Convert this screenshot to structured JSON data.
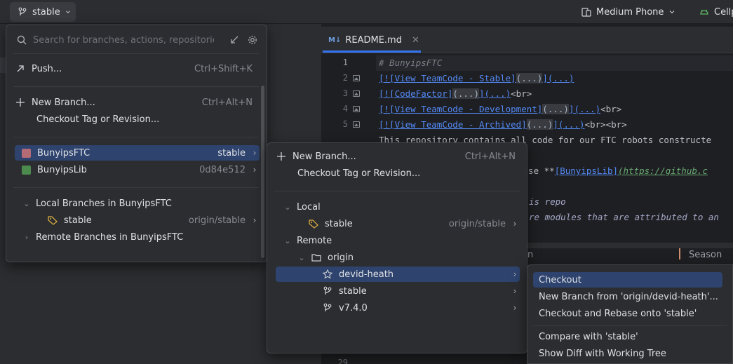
{
  "toolbar": {
    "branch": "stable",
    "device": "Medium Phone",
    "cell_label": "Cellp"
  },
  "editor": {
    "tab_label": "README.md",
    "tab_badge": "M↓",
    "line_numbers": [
      "1",
      "2",
      "3",
      "4",
      "5",
      "29"
    ],
    "table_header_right": "Season",
    "table_header_left": "n"
  },
  "branch_popup": {
    "search_placeholder": "Search for branches, actions, repositories",
    "push": {
      "label": "Push...",
      "shortcut": "Ctrl+Shift+K"
    },
    "new_branch": {
      "label": "New Branch...",
      "shortcut": "Ctrl+Alt+N"
    },
    "checkout_tag": "Checkout Tag or Revision...",
    "repos": [
      {
        "name": "BunyipsFTC",
        "branch": "stable",
        "color": "#b36b76"
      },
      {
        "name": "BunyipsLib",
        "branch": "0d84e512",
        "color": "#4d8a4d"
      }
    ],
    "local_header": "Local Branches in BunyipsFTC",
    "local_branch": {
      "name": "stable",
      "tracking": "origin/stable"
    },
    "remote_header": "Remote Branches in BunyipsFTC"
  },
  "repo_popup": {
    "new_branch": {
      "label": "New Branch...",
      "shortcut": "Ctrl+Alt+N"
    },
    "checkout_tag": "Checkout Tag or Revision...",
    "local_header": "Local",
    "local_branch": {
      "name": "stable",
      "tracking": "origin/stable"
    },
    "remote_header": "Remote",
    "remote_name": "origin",
    "remote_branches": [
      "devid-heath",
      "stable",
      "v7.4.0"
    ]
  },
  "branch_actions": {
    "items": [
      "Checkout",
      "New Branch from 'origin/devid-heath'...",
      "Checkout and Rebase onto 'stable'",
      "Compare with 'stable'",
      "Show Diff with Working Tree"
    ]
  },
  "code": {
    "l1": "# BunyipsFTC",
    "l2_link": "[![View TeamCode - Stable]",
    "l3_link": "[![CodeFactor]",
    "l4_link": "[![View TeamCode - Development]",
    "l5_link": "[![View TeamCode - Archived]",
    "fold": "(...)",
    "fold_bracket": "](...)",
    "br": "<br>",
    "brbr": "<br><br>",
    "close": ")",
    "l6": "This repository contains all code for our FTC robots constructe",
    "l8_a": "lise **",
    "l8_link": "[BunyipsLib]",
    "l8_url": "(https://github.c",
    "l10": "is repo",
    "l11": "re modules that are attributed to an"
  }
}
